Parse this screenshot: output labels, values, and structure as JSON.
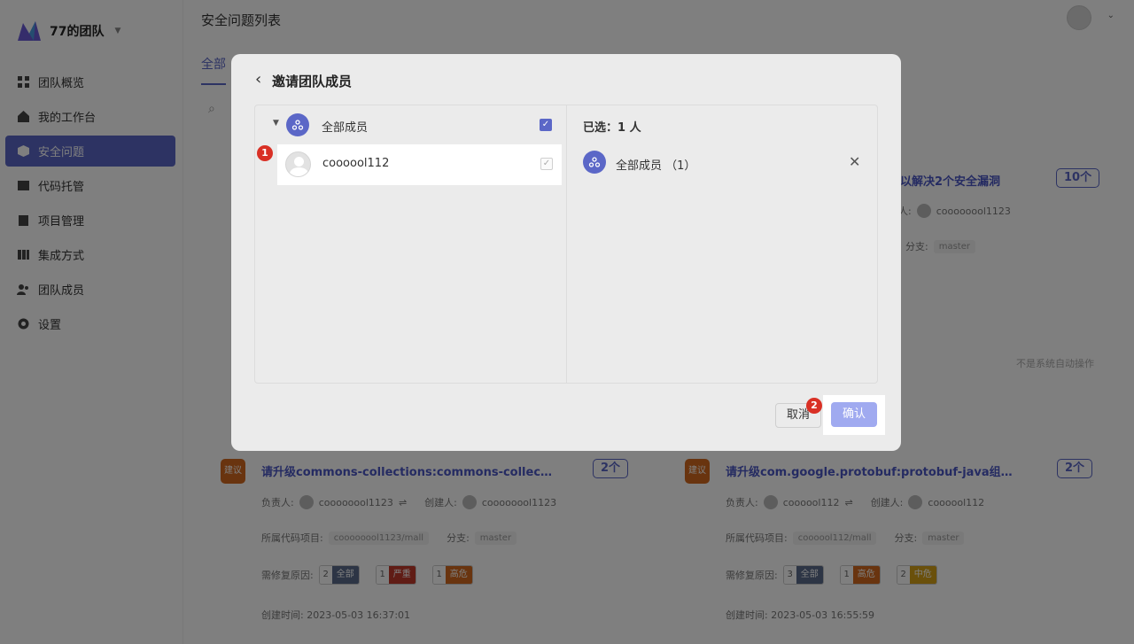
{
  "sidebar": {
    "team_name": "77的团队",
    "items": [
      {
        "label": "团队概览",
        "icon": "dashboard-icon",
        "active": false
      },
      {
        "label": "我的工作台",
        "icon": "home-icon",
        "active": false
      },
      {
        "label": "安全问题",
        "icon": "cube-icon",
        "active": true
      },
      {
        "label": "代码托管",
        "icon": "code-icon",
        "active": false
      },
      {
        "label": "项目管理",
        "icon": "clipboard-icon",
        "active": false
      },
      {
        "label": "集成方式",
        "icon": "integration-icon",
        "active": false
      },
      {
        "label": "团队成员",
        "icon": "users-icon",
        "active": false
      },
      {
        "label": "设置",
        "icon": "gear-icon",
        "active": false
      }
    ]
  },
  "header": {
    "page_title": "安全问题列表",
    "tab_all": "全部"
  },
  "cards": [
    {
      "title": "以解决2个安全漏洞",
      "count": "10个",
      "owner_label": "人:",
      "owner": "coooooool1123",
      "branch_label": "分支:",
      "branch": "master"
    },
    {
      "tag": "建议",
      "title": "请升级commons-collections:commons-collections组...",
      "count": "2个",
      "owner_label": "负责人:",
      "owner": "coooooool1123",
      "creator_label": "创建人:",
      "creator": "coooooool1123",
      "repo_label": "所属代码项目:",
      "repo": "coooooool1123/mall",
      "branch_label": "分支:",
      "branch": "master",
      "fix_label": "需修复原因:",
      "fix_badges": [
        {
          "n": "2",
          "label": "全部",
          "color": "#5a6b8a"
        },
        {
          "n": "1",
          "label": "严重",
          "color": "#c0392b"
        },
        {
          "n": "1",
          "label": "高危",
          "color": "#d2691e"
        }
      ],
      "created": "创建时间: 2023-05-03 16:37:01"
    },
    {
      "tag": "建议",
      "title": "请升级com.google.protobuf:protobuf-java组件版本以...",
      "count": "2个",
      "owner_label": "负责人:",
      "owner": "coooool112",
      "creator_label": "创建人:",
      "creator": "coooool112",
      "repo_label": "所属代码项目:",
      "repo": "coooool112/mall",
      "branch_label": "分支:",
      "branch": "master",
      "fix_label": "需修复原因:",
      "fix_badges": [
        {
          "n": "3",
          "label": "全部",
          "color": "#5a6b8a"
        },
        {
          "n": "1",
          "label": "高危",
          "color": "#d2691e"
        },
        {
          "n": "2",
          "label": "中危",
          "color": "#d4a017"
        }
      ],
      "created": "创建时间: 2023-05-03 16:55:59"
    }
  ],
  "note": "不是系统自动操作",
  "modal": {
    "title": "邀请团队成员",
    "group_label": "全部成员",
    "member_name": "coooool112",
    "selected_title": "已选：1 人",
    "selected_item": "全部成员  （1）",
    "cancel_label": "取消",
    "confirm_label": "确认"
  },
  "markers": {
    "one": "1",
    "two": "2"
  },
  "colors": {
    "accent": "#5b67c7",
    "confirm": "#a0aaf0",
    "marker": "#d93025"
  }
}
